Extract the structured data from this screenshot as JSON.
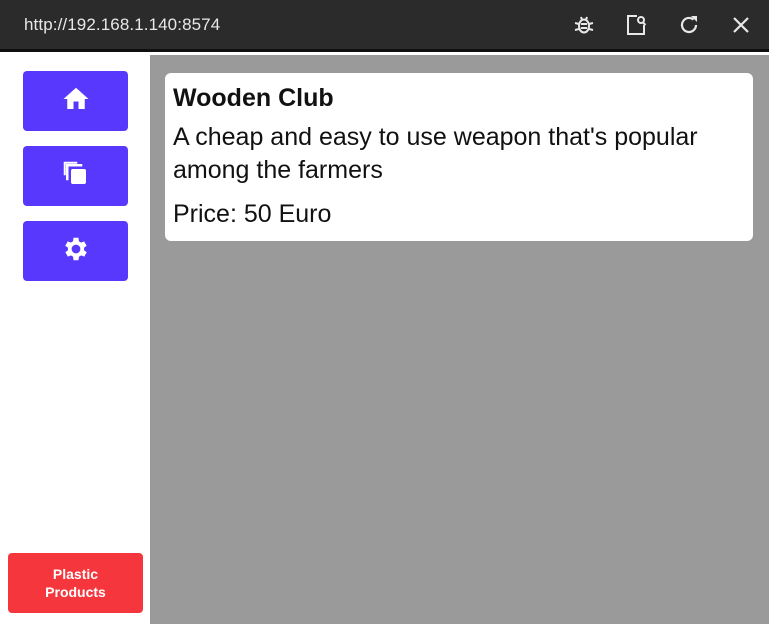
{
  "window": {
    "url": "http://192.168.1.140:8574",
    "icons": [
      "bug-icon",
      "open-external-icon",
      "refresh-icon",
      "close-icon"
    ]
  },
  "sidebar": {
    "nav": [
      {
        "icon": "home-icon",
        "color": "#5838fc"
      },
      {
        "icon": "copy-icon",
        "color": "#5838fc"
      },
      {
        "icon": "gear-icon",
        "color": "#5838fc"
      }
    ],
    "plastic_button": {
      "line1": "Plastic",
      "line2": "Products",
      "color": "#f5363d"
    }
  },
  "product": {
    "title": "Wooden Club",
    "description_line1": "A cheap and easy to use weapon that's popular",
    "description_line2": "among the farmers",
    "price": "Price: 50 Euro"
  }
}
